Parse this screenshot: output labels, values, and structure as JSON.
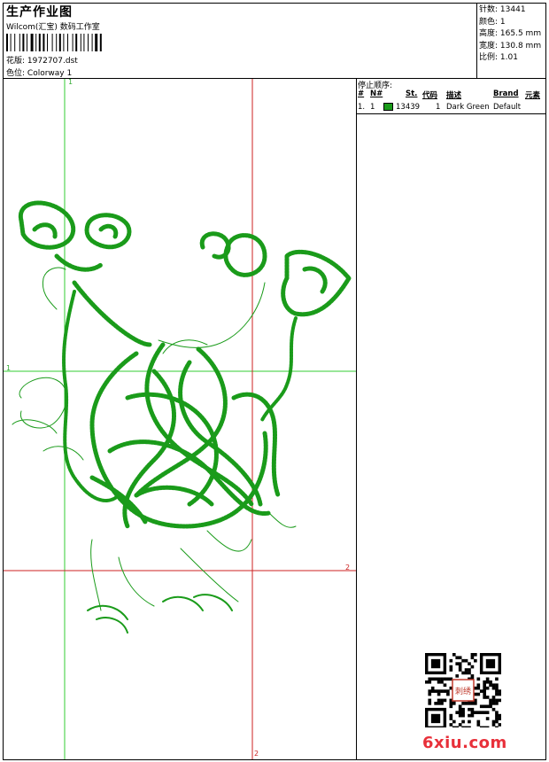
{
  "header": {
    "title": "生产作业图",
    "studio": "Wilcom(汇宝) 数码工作室",
    "pattern_label": "花版:",
    "pattern_value": "1972707.dst",
    "colorway_label": "色位:",
    "colorway_value": "Colorway 1"
  },
  "stats": [
    {
      "label": "针数:",
      "value": "13441"
    },
    {
      "label": "颜色:",
      "value": "1"
    },
    {
      "label": "高度:",
      "value": "165.5 mm"
    },
    {
      "label": "宽度:",
      "value": "130.8 mm"
    },
    {
      "label": "比例:",
      "value": "1.01"
    }
  ],
  "stop_sequence": {
    "title": "停止顺序:",
    "columns": [
      "#",
      "N#",
      "St.",
      "代码",
      "描述",
      "Brand",
      "元素"
    ],
    "rows": [
      {
        "index": "1.",
        "n": "1",
        "color": "#1a9b1a",
        "stitches": "13439",
        "code": "1",
        "description": "Dark Green",
        "brand": "Default"
      }
    ]
  },
  "grid_labels": {
    "top_v1": "1",
    "left_h1": "1",
    "right_h2": "2",
    "bottom_v2": "2"
  },
  "watermark": {
    "seal_text": "刺绣",
    "logo": "6xiu.com"
  },
  "colors": {
    "thread": "#1a9b1a",
    "guide_green": "#33cc33",
    "guide_red": "#cc2222"
  }
}
